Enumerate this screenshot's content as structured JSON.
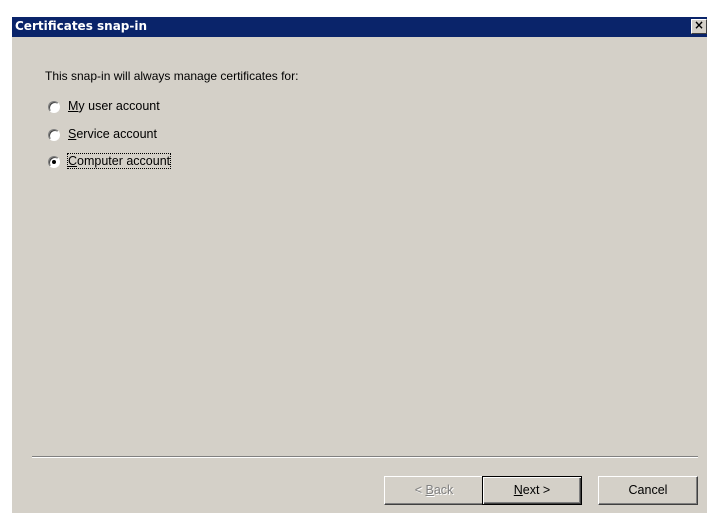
{
  "window": {
    "title": "Certificates snap-in",
    "close_glyph": "×"
  },
  "prompt": "This snap-in will always manage certificates for:",
  "options": [
    {
      "accel": "M",
      "rest": "y user account",
      "label": "My user account",
      "selected": false
    },
    {
      "accel": "S",
      "rest": "ervice account",
      "label": "Service account",
      "selected": false
    },
    {
      "accel": "C",
      "rest": "omputer account",
      "label": "Computer account",
      "selected": true
    }
  ],
  "buttons": {
    "back": {
      "prefix": "< ",
      "accel": "B",
      "rest": "ack",
      "label": "< Back",
      "enabled": false
    },
    "next": {
      "prefix": "",
      "accel": "N",
      "rest": "ext >",
      "label": "Next >",
      "enabled": true
    },
    "cancel": {
      "label": "Cancel",
      "enabled": true
    }
  },
  "colors": {
    "title_bar": "#0a246a",
    "dialog_bg": "#d4d0c8",
    "disabled_text": "#808080"
  }
}
